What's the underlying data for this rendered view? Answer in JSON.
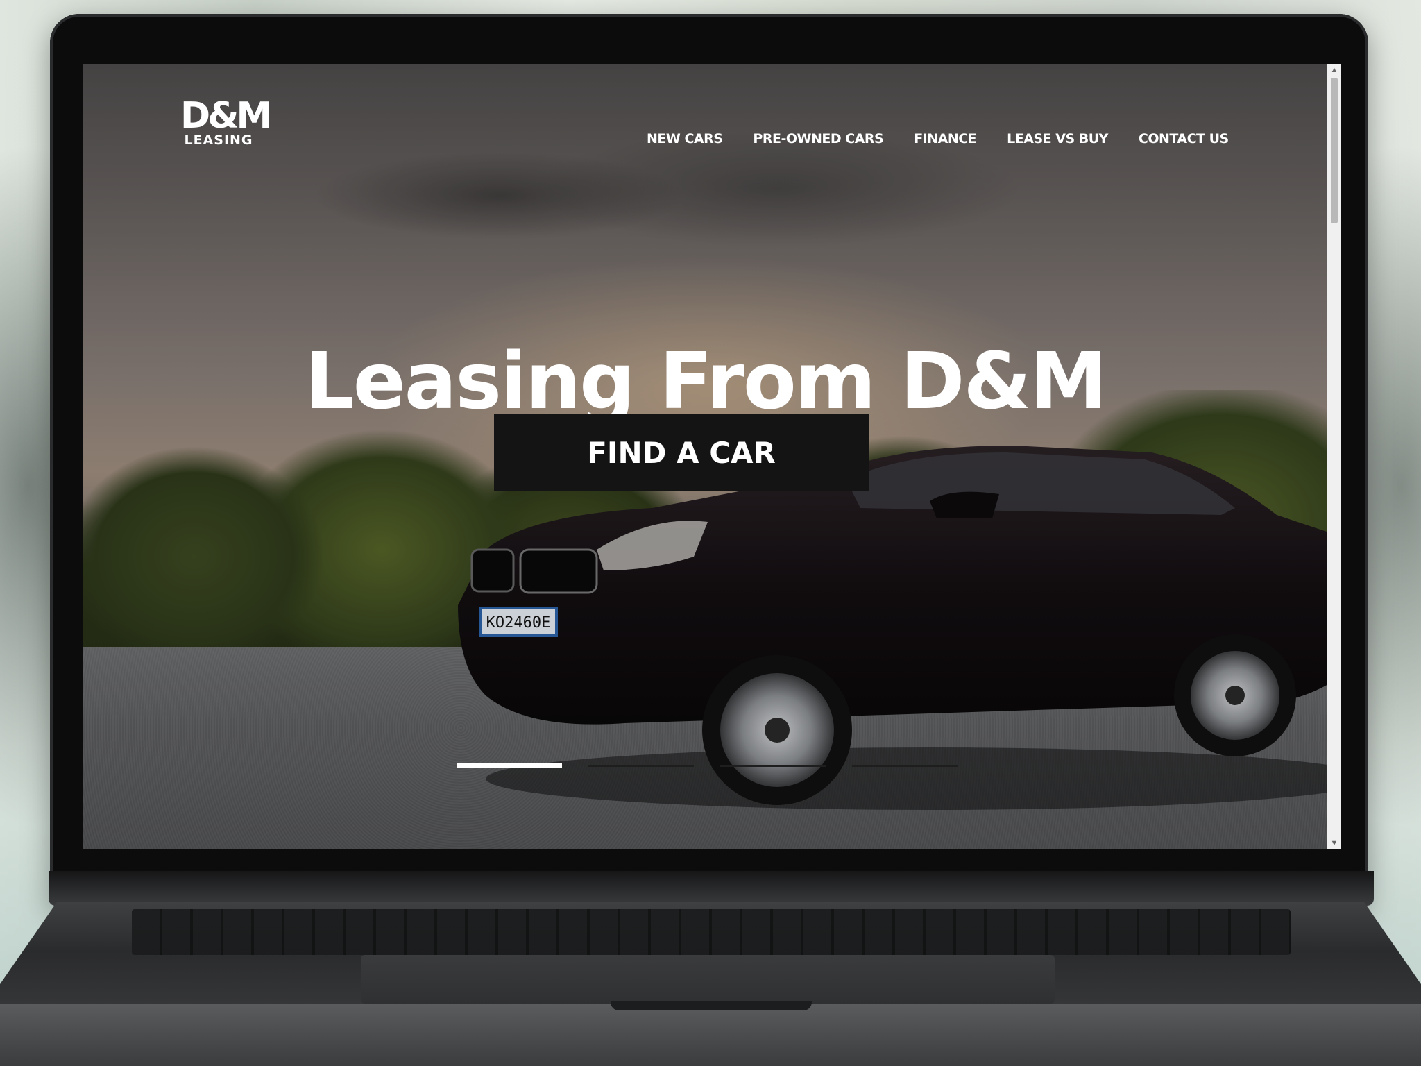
{
  "site": {
    "logo": {
      "mark": "D&M",
      "sub": "LEASING"
    },
    "nav": [
      {
        "label": "NEW CARS"
      },
      {
        "label": "PRE-OWNED CARS"
      },
      {
        "label": "FINANCE"
      },
      {
        "label": "LEASE VS BUY"
      },
      {
        "label": "CONTACT US"
      }
    ],
    "hero": {
      "title": "Leasing From D&M",
      "cta_label": "FIND A CAR",
      "plate": "KO2460E"
    },
    "slider": {
      "count": 4,
      "active_index": 0
    }
  },
  "colors": {
    "cta_bg": "#141414",
    "text": "#ffffff",
    "indicator_active": "#ffffff",
    "indicator_inactive": "#1e1e1e"
  }
}
